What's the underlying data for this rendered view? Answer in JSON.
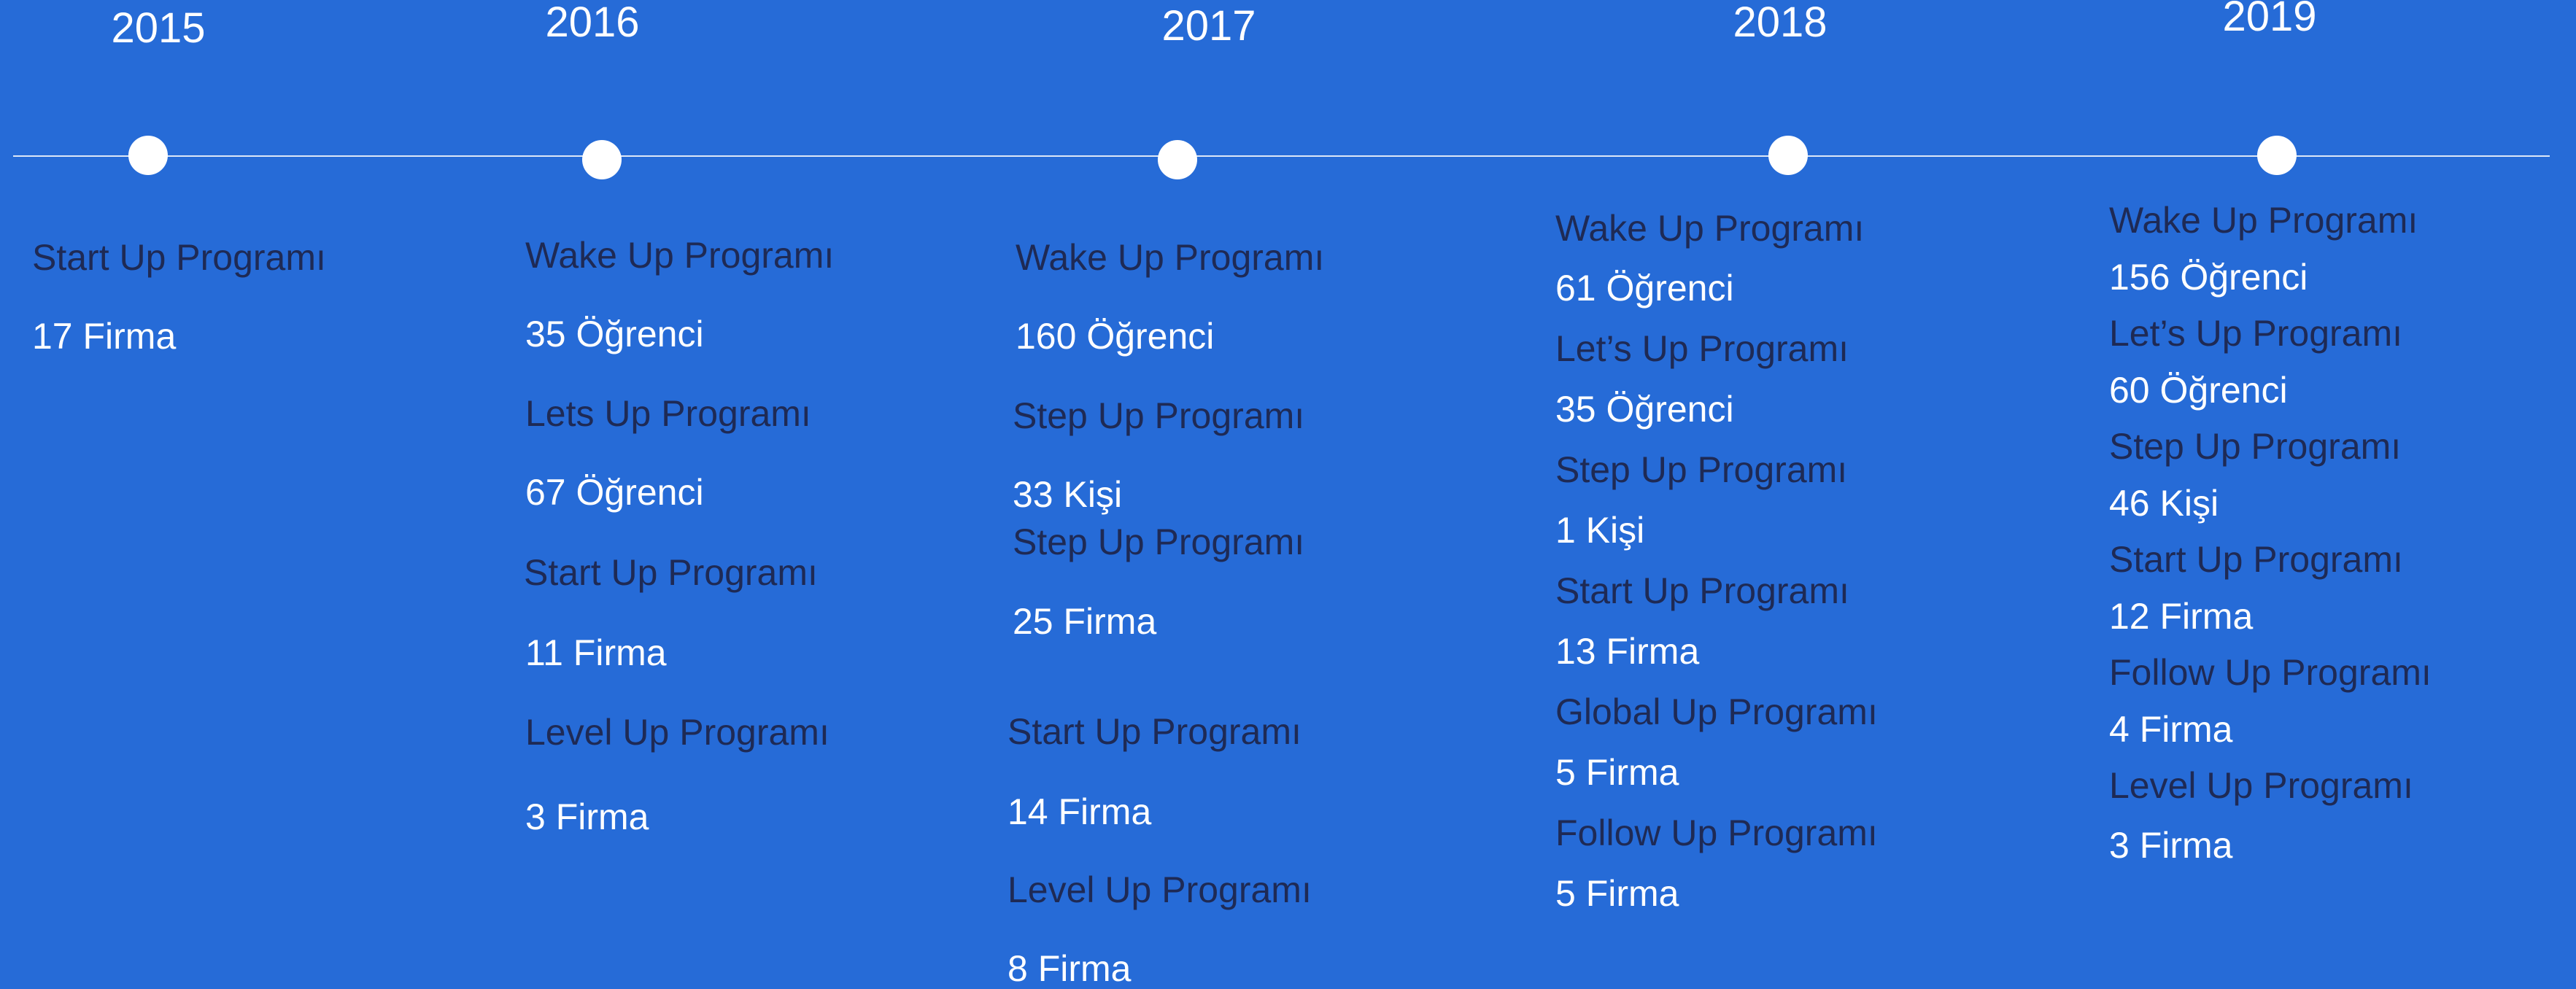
{
  "colors": {
    "background": "#266BD7",
    "program_text": "#1E2A55",
    "value_text": "#FFFFFF",
    "line": "#DCE7F8",
    "dot": "#FFFFFF"
  },
  "years": [
    "2015",
    "2016",
    "2017",
    "2018",
    "2019"
  ],
  "columns": [
    {
      "year": "2015",
      "entries": [
        {
          "program": "Start Up Programı",
          "value": "17 Firma"
        }
      ]
    },
    {
      "year": "2016",
      "entries": [
        {
          "program": "Wake Up Programı",
          "value": "35 Öğrenci"
        },
        {
          "program": "Lets Up Programı",
          "value": "67 Öğrenci"
        },
        {
          "program": "Start Up Programı",
          "value": "11 Firma"
        },
        {
          "program": "Level Up Programı",
          "value": "3 Firma"
        }
      ]
    },
    {
      "year": "2017",
      "entries": [
        {
          "program": "Wake Up Programı",
          "value": "160 Öğrenci"
        },
        {
          "program": "Step Up Programı",
          "value": "33 Kişi"
        },
        {
          "program": "Step Up Programı",
          "value": "25 Firma"
        },
        {
          "program": "Start Up Programı",
          "value": "14 Firma"
        },
        {
          "program": "Level Up Programı",
          "value": "8 Firma"
        }
      ]
    },
    {
      "year": "2018",
      "entries": [
        {
          "program": "Wake Up Programı",
          "value": "61 Öğrenci"
        },
        {
          "program": "Let’s Up Programı",
          "value": "35 Öğrenci"
        },
        {
          "program": "Step Up Programı",
          "value": "1 Kişi"
        },
        {
          "program": "Start Up Programı",
          "value": "13 Firma"
        },
        {
          "program": "Global Up Programı",
          "value": "5 Firma"
        },
        {
          "program": "Follow Up Programı",
          "value": "5 Firma"
        }
      ]
    },
    {
      "year": "2019",
      "entries": [
        {
          "program": "Wake Up Programı",
          "value": "156 Öğrenci"
        },
        {
          "program": "Let’s Up Programı",
          "value": "60 Öğrenci"
        },
        {
          "program": "Step Up Programı",
          "value": "46 Kişi"
        },
        {
          "program": "Start Up Programı",
          "value": "12 Firma"
        },
        {
          "program": "Follow Up Programı",
          "value": "4 Firma"
        },
        {
          "program": "Level Up Programı",
          "value": "3 Firma"
        }
      ]
    }
  ]
}
